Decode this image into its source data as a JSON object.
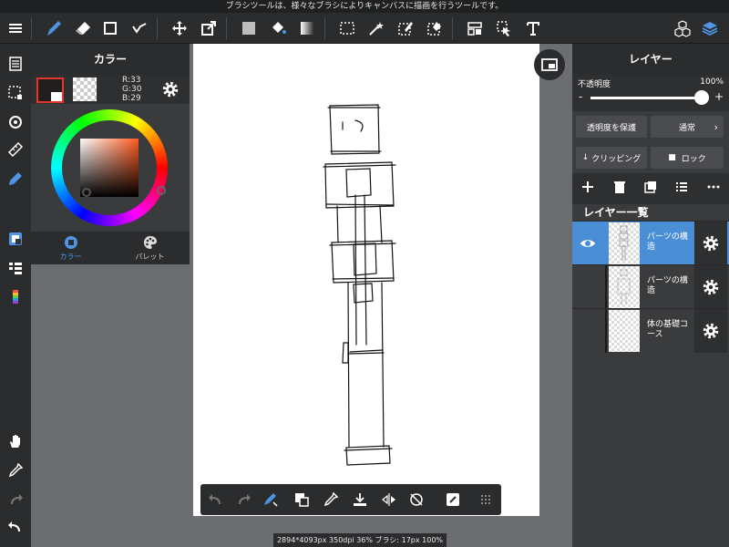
{
  "hint_text": "ブラシツールは、様々なブラシによりキャンバスに描画を行うツールです。",
  "toolbar": {
    "items": [
      "menu-icon",
      "brush-icon",
      "eraser-icon",
      "rectangle-icon",
      "correction-icon",
      "move-icon",
      "transform-icon",
      "fill-color-icon",
      "bucket-icon",
      "gradient-icon",
      "select-icon",
      "magic-wand-icon",
      "select-pen-icon",
      "select-eraser-icon",
      "material-icon",
      "operation-icon",
      "text-icon",
      "3d-icon",
      "layers-icon"
    ]
  },
  "color_panel": {
    "title": "カラー",
    "rgb": {
      "r": "R:33",
      "g": "G:30",
      "b": "B:29"
    },
    "foreground": "#211e1d",
    "tabs": [
      {
        "label": "カラー",
        "icon": "color-icon",
        "active": true
      },
      {
        "label": "パレット",
        "icon": "palette-icon",
        "active": false
      }
    ]
  },
  "layer_panel": {
    "title": "レイヤー",
    "opacity_label": "不透明度",
    "opacity_value": "100%",
    "opacity_minus": "-",
    "opacity_plus": "+",
    "protect_alpha_label": "透明度を保護",
    "blend_mode_label": "通常",
    "clipping_label": "クリッピング",
    "lock_label": "ロック",
    "list_title": "レイヤー一覧",
    "layers": [
      {
        "name": "パーツの構造",
        "visible": true,
        "selected": true
      },
      {
        "name": "パーツの構造",
        "visible": false,
        "selected": false
      },
      {
        "name": "体の基礎コース",
        "visible": false,
        "selected": false
      }
    ]
  },
  "status_text": "2894*4093px 350dpi 36% ブラシ: 17px 100%"
}
